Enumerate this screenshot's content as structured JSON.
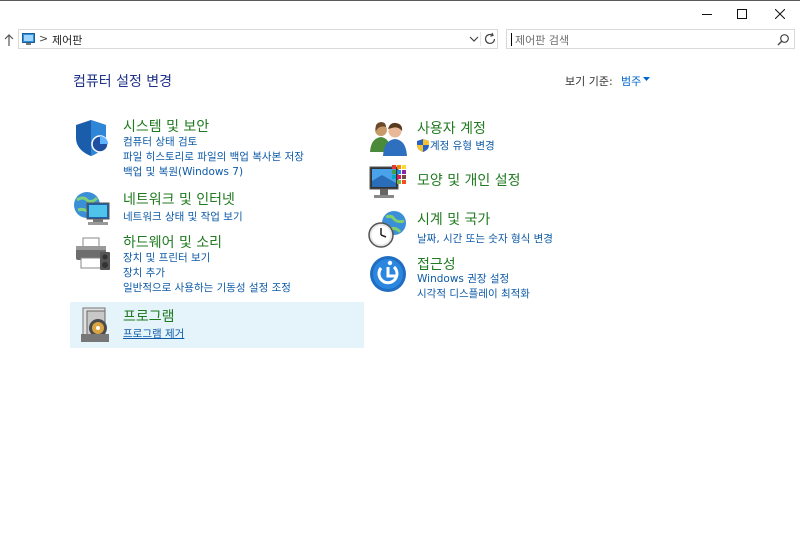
{
  "window": {
    "controls": [
      "minimize",
      "maximize",
      "close"
    ]
  },
  "address_bar": {
    "separator": ">",
    "crumb": "제어판"
  },
  "search": {
    "placeholder": "제어판 검색"
  },
  "main": {
    "title": "컴퓨터 설정 변경",
    "view_by_label": "보기 기준:",
    "view_by_value": "범주"
  },
  "categories": [
    {
      "name": "시스템 및 보안",
      "icon": "shield-icon",
      "links": [
        "컴퓨터 상태 검토",
        "파일 히스토리로 파일의 백업 복사본 저장",
        "백업 및 복원(Windows 7)"
      ]
    },
    {
      "name": "네트워크 및 인터넷",
      "icon": "network-icon",
      "links": [
        "네트워크 상태 및 작업 보기"
      ]
    },
    {
      "name": "하드웨어 및 소리",
      "icon": "printer-icon",
      "links": [
        "장치 및 프린터 보기",
        "장치 추가",
        "일반적으로 사용하는 기동성 설정 조정"
      ]
    },
    {
      "name": "프로그램",
      "icon": "programs-icon",
      "links": [
        "프로그램 제거"
      ]
    },
    {
      "name": "사용자 계정",
      "icon": "users-icon",
      "links": [
        "계정 유형 변경"
      ]
    },
    {
      "name": "모양 및 개인 설정",
      "icon": "display-icon",
      "links": []
    },
    {
      "name": "시계 및 국가",
      "icon": "clock-globe-icon",
      "links": [
        "날짜, 시간 또는 숫자 형식 변경"
      ]
    },
    {
      "name": "접근성",
      "icon": "ease-of-access-icon",
      "links": [
        "Windows 권장 설정",
        "시각적 디스플레이 최적화"
      ]
    }
  ],
  "colors": {
    "heading": "#207a20",
    "link": "#0d5aa7",
    "title": "#1e3287",
    "hover": "#e5f3fb"
  }
}
